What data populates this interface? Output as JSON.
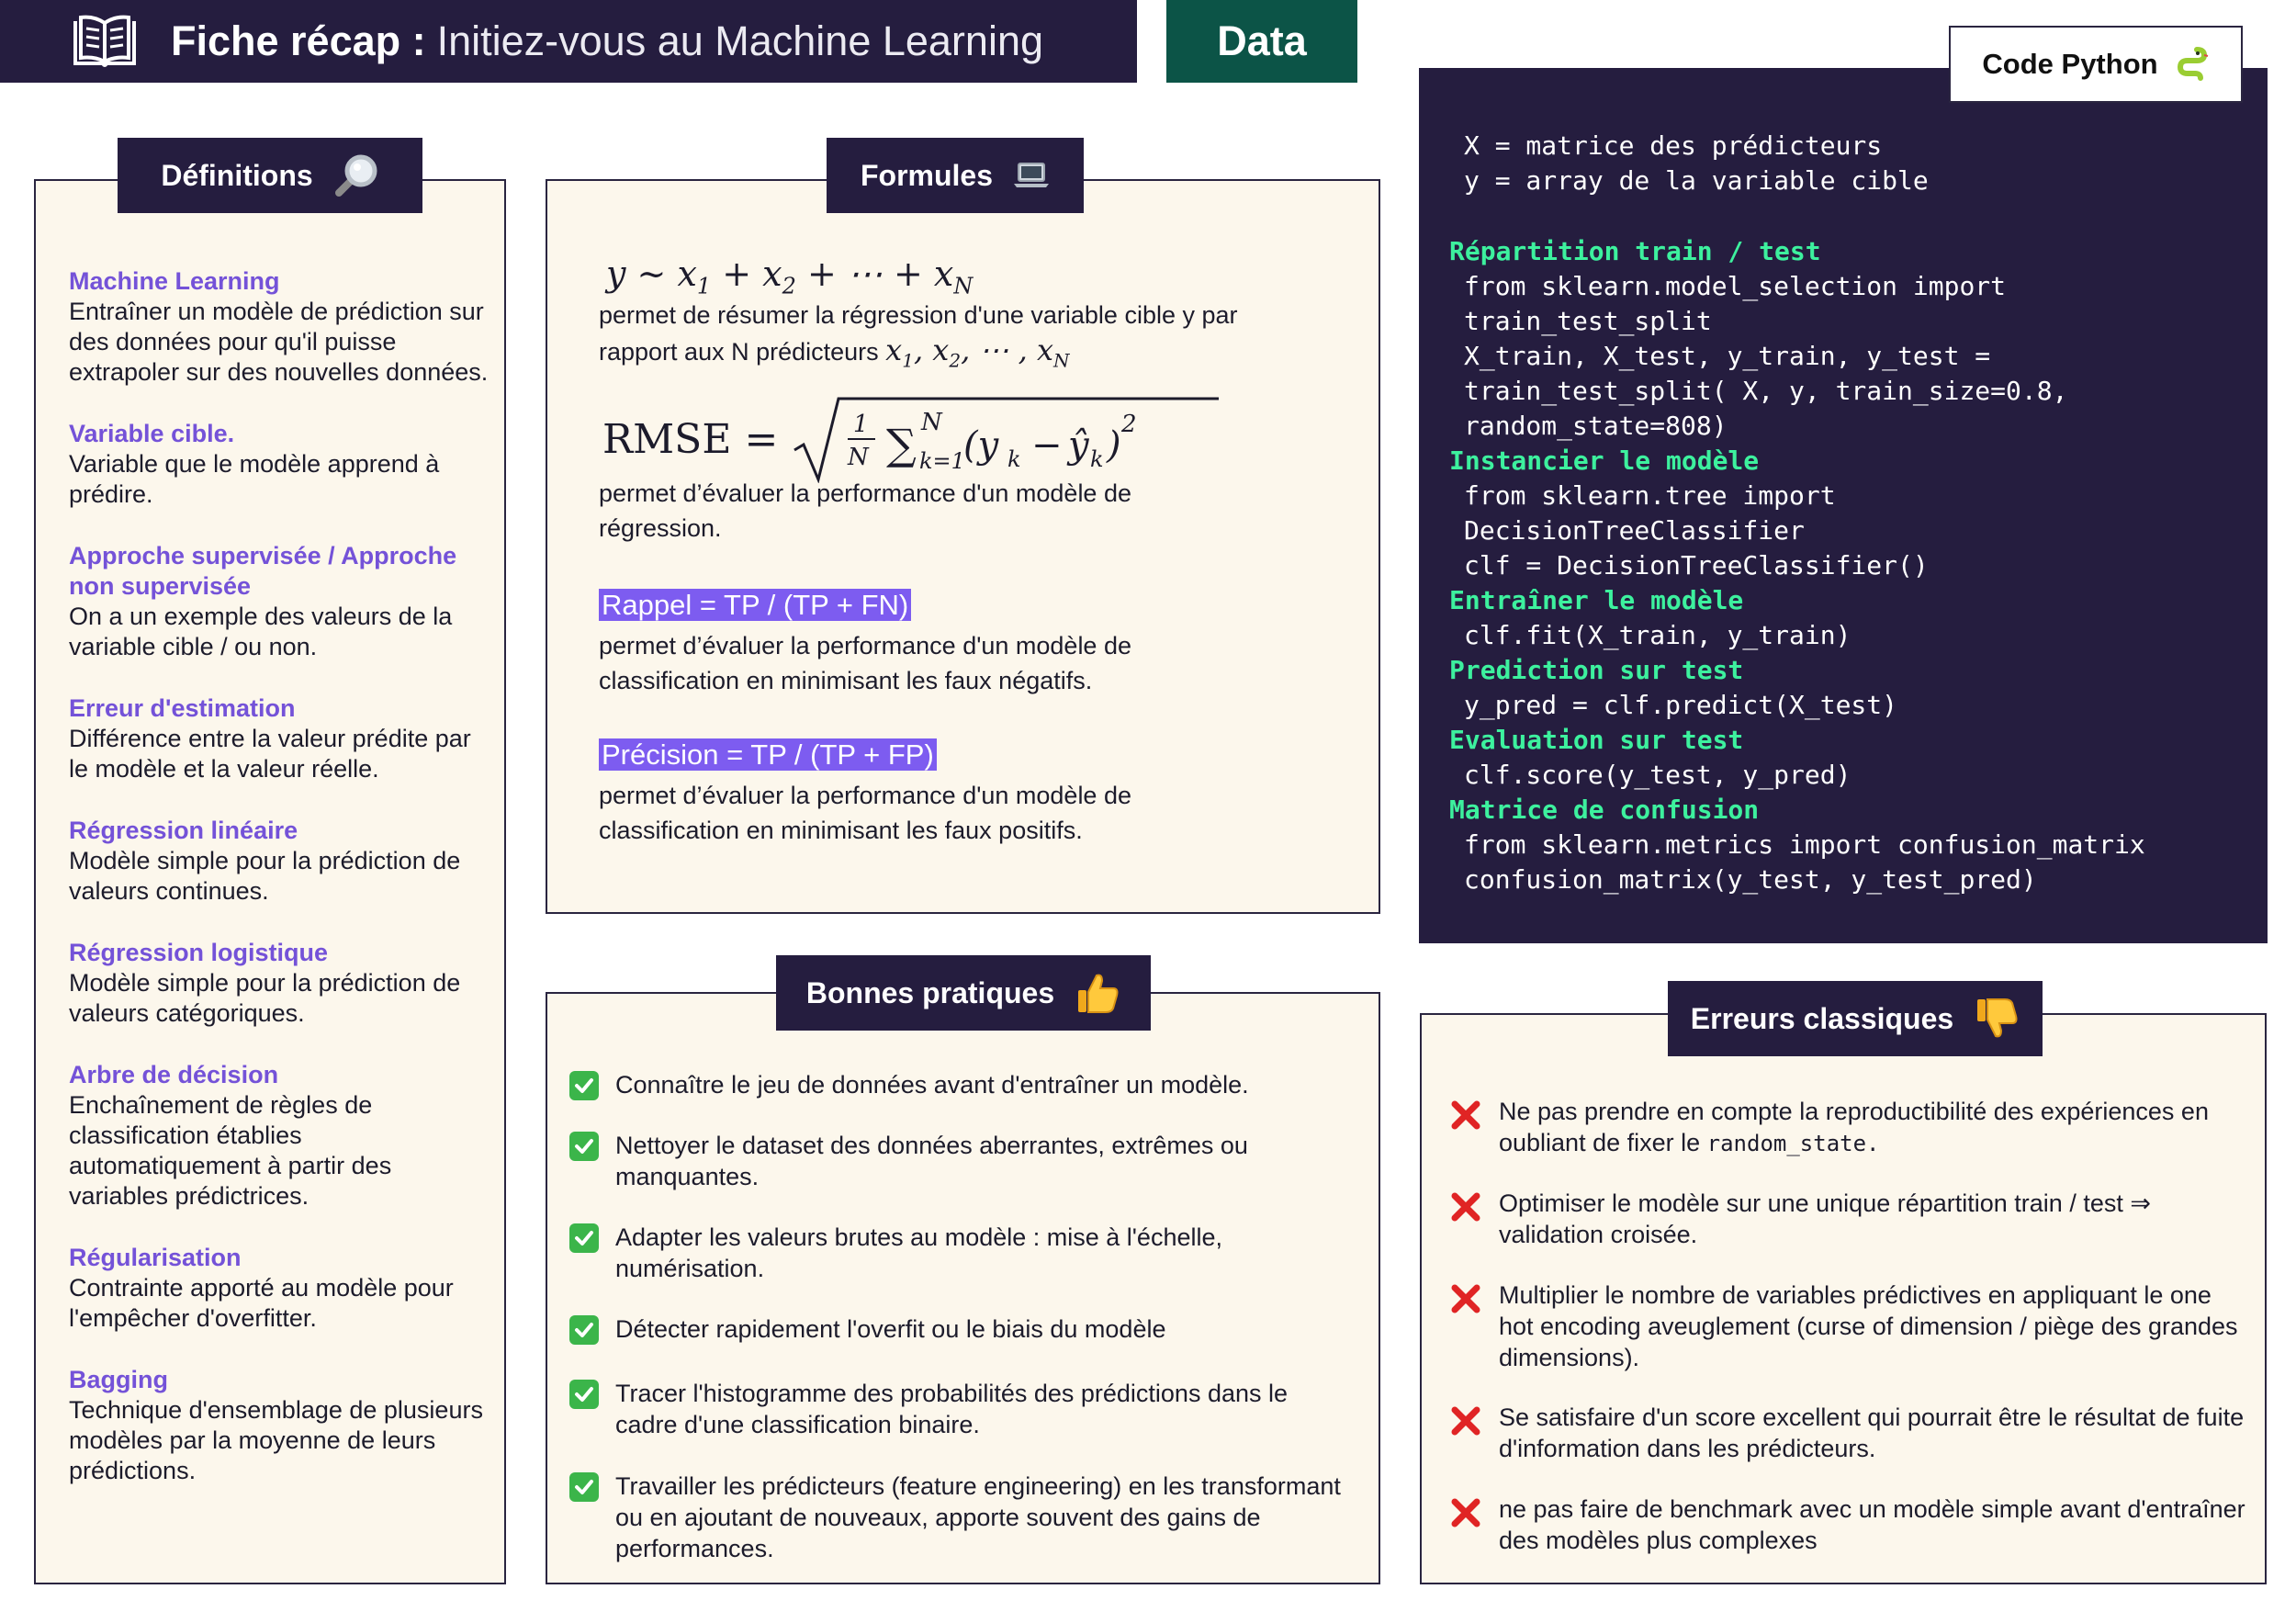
{
  "header": {
    "title_bold": "Fiche récap :",
    "title_rest": "Initiez-vous au Machine Learning",
    "tag": "Data",
    "book_icon": "open-book-icon"
  },
  "definitions": {
    "title": "Définitions",
    "icon": "magnifying-glass-icon",
    "items": [
      {
        "term": "Machine Learning",
        "desc": "Entraîner un modèle de prédiction sur des données pour qu'il puisse extrapoler sur des nouvelles données."
      },
      {
        "term": "Variable cible.",
        "desc": "Variable que le modèle apprend à prédire."
      },
      {
        "term": "Approche supervisée / Approche non supervisée",
        "desc": "On a un exemple des valeurs de la variable cible / ou non."
      },
      {
        "term": "Erreur d'estimation",
        "desc": "Différence entre la valeur prédite par le modèle et la valeur réelle."
      },
      {
        "term": "Régression linéaire",
        "desc": "Modèle simple pour la prédiction de valeurs continues."
      },
      {
        "term": "Régression logistique",
        "desc": "Modèle simple pour la prédiction de valeurs catégoriques."
      },
      {
        "term": "Arbre de décision",
        "desc": "Enchaînement de règles de classification établies automatiquement à partir des variables prédictrices."
      },
      {
        "term": "Régularisation",
        "desc": "Contrainte apporté au modèle pour l'empêcher d'overfitter."
      },
      {
        "term": "Bagging",
        "desc": "Technique d'ensemblage de plusieurs modèles par la moyenne de leurs prédictions."
      }
    ]
  },
  "formulas": {
    "title": "Formules",
    "icon": "laptop-icon",
    "f1_desc_1": "permet de résumer la régression d'une variable cible y par",
    "f1_desc_2": "rapport aux N prédicteurs",
    "f2_label": "RMSE",
    "f2_desc": "permet d’évaluer la performance d'un modèle de régression.",
    "f3_label": "Rappel = TP / (TP + FN)",
    "f3_desc": "permet d’évaluer la performance d'un modèle de classification en minimisant les faux négatifs.",
    "f4_label": "Précision = TP / (TP + FP)",
    "f4_desc": "permet d’évaluer la performance d'un modèle de classification en minimisant les faux positifs."
  },
  "code": {
    "title": "Code Python",
    "icon": "python-snake-icon",
    "lines": [
      {
        "text": "X = matrice des prédicteurs",
        "kind": "code"
      },
      {
        "text": "y = array de la variable cible",
        "kind": "code"
      },
      {
        "text": "Répartition train / test",
        "kind": "section"
      },
      {
        "text": "from sklearn.model_selection import",
        "kind": "code"
      },
      {
        "text": "train_test_split",
        "kind": "code"
      },
      {
        "text": "X_train, X_test, y_train, y_test =",
        "kind": "code"
      },
      {
        "text": "train_test_split( X, y, train_size=0.8,",
        "kind": "code"
      },
      {
        "text": "random_state=808)",
        "kind": "code"
      },
      {
        "text": "Instancier le modèle",
        "kind": "section"
      },
      {
        "text": "from sklearn.tree import",
        "kind": "code"
      },
      {
        "text": "DecisionTreeClassifier",
        "kind": "code"
      },
      {
        "text": "clf = DecisionTreeClassifier()",
        "kind": "code"
      },
      {
        "text": "Entraîner le modèle",
        "kind": "section"
      },
      {
        "text": "clf.fit(X_train, y_train)",
        "kind": "code"
      },
      {
        "text": "Prediction sur test",
        "kind": "section"
      },
      {
        "text": "y_pred = clf.predict(X_test)",
        "kind": "code"
      },
      {
        "text": "Evaluation sur test",
        "kind": "section"
      },
      {
        "text": "clf.score(y_test, y_pred)",
        "kind": "code"
      },
      {
        "text": "Matrice de confusion",
        "kind": "section"
      },
      {
        "text": "from sklearn.metrics import confusion_matrix",
        "kind": "code"
      },
      {
        "text": "confusion_matrix(y_test, y_test_pred)",
        "kind": "code"
      }
    ]
  },
  "good_practices": {
    "title": "Bonnes pratiques",
    "icon": "thumbs-up-icon",
    "item_icon": "check-mark-icon",
    "items": [
      "Connaître le jeu de données avant d'entraîner un modèle.",
      "Nettoyer le dataset des données aberrantes, extrêmes ou manquantes.",
      "Adapter les valeurs brutes au modèle : mise à l'échelle, numérisation.",
      "Détecter rapidement l'overfit ou le biais du modèle",
      "Tracer l'histogramme des probabilités des prédictions dans le cadre d'une classification binaire.",
      "Travailler les prédicteurs (feature engineering) en les transformant ou en ajoutant de nouveaux, apporte souvent des gains de performances."
    ]
  },
  "errors": {
    "title": "Erreurs classiques",
    "icon": "thumbs-down-icon",
    "item_icon": "cross-mark-icon",
    "item1_text": "Ne pas prendre en compte la reproductibilité des expériences en oubliant de fixer le",
    "item1_code": "random_state.",
    "items": [
      "Optimiser le modèle sur une unique répartition train / test ⇒ validation croisée.",
      "Multiplier le nombre de variables prédictives en appliquant le one hot encoding aveuglement (curse of dimension / piège des grandes dimensions).",
      "Se satisfaire d'un score excellent qui pourrait être le résultat de fuite d'information dans les prédicteurs.",
      "ne pas faire de benchmark avec un modèle simple avant d'entraîner des modèles plus complexes"
    ]
  },
  "colors": {
    "navy": "#251d3f",
    "teal": "#0c5447",
    "purple": "#7452d8",
    "code_green": "#3df19e",
    "card_bg": "#fcf7ec",
    "check_green": "#3bb54a",
    "cross_red": "#e02424"
  }
}
